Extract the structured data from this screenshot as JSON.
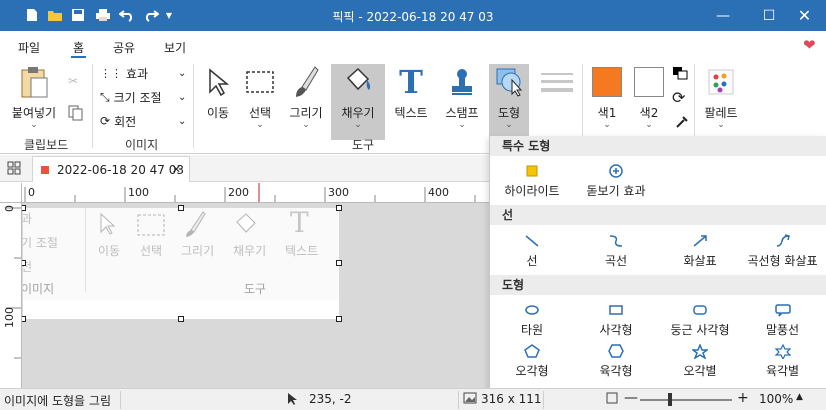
{
  "window": {
    "title": "픽픽 - 2022-06-18 20 47 03"
  },
  "menu_tabs": [
    "파일",
    "홈",
    "공유",
    "보기"
  ],
  "ribbon": {
    "clipboard": {
      "paste_label": "붙여넣기",
      "group_label": "클립보드"
    },
    "image": {
      "effect_label": "효과",
      "resize_label": "크기 조절",
      "rotate_label": "회전",
      "group_label": "이미지"
    },
    "tools": {
      "group_label": "도구",
      "items": [
        {
          "label": "이동"
        },
        {
          "label": "선택"
        },
        {
          "label": "그리기"
        },
        {
          "label": "채우기"
        },
        {
          "label": "텍스트"
        },
        {
          "label": "스탬프"
        },
        {
          "label": "도형"
        }
      ]
    },
    "colors": {
      "color1_label": "색1",
      "color2_label": "색2",
      "palette_label": "팔레트",
      "color1": "#f47920",
      "color2": "#ffffff"
    }
  },
  "document_tab": {
    "title": "2022-06-18 20 47 03"
  },
  "ruler": {
    "h_ticks": [
      "0",
      "100",
      "200",
      "300",
      "400"
    ],
    "v_ticks": [
      "0",
      "100"
    ]
  },
  "image_preview": {
    "tools_label": "도구",
    "image_label": "이미지",
    "resize_fragment": "기 조절",
    "effect_fragment": "과",
    "rotate_fragment": "전",
    "items": [
      "이동",
      "선택",
      "그리기",
      "채우기",
      "텍스트"
    ]
  },
  "shape_menu": {
    "special": {
      "header": "특수 도형",
      "items": [
        "하이라이트",
        "돋보기 효과"
      ]
    },
    "lines": {
      "header": "선",
      "items": [
        "선",
        "곡선",
        "화살표",
        "곡선형 화살표"
      ]
    },
    "shapes": {
      "header": "도형",
      "items": [
        "타원",
        "사각형",
        "둥근 사각형",
        "말풍선",
        "오각형",
        "육각형",
        "오각별",
        "육각별"
      ]
    }
  },
  "status": {
    "message": "이미지에 도형을 그림",
    "cursor": "235, -2",
    "size": "316 x 111",
    "zoom": "100%"
  },
  "colors": {
    "titlebar": "#2b6fb5",
    "accent": "#2b6fb5",
    "heart": "#e0495a",
    "highlight": "#f5c300"
  }
}
